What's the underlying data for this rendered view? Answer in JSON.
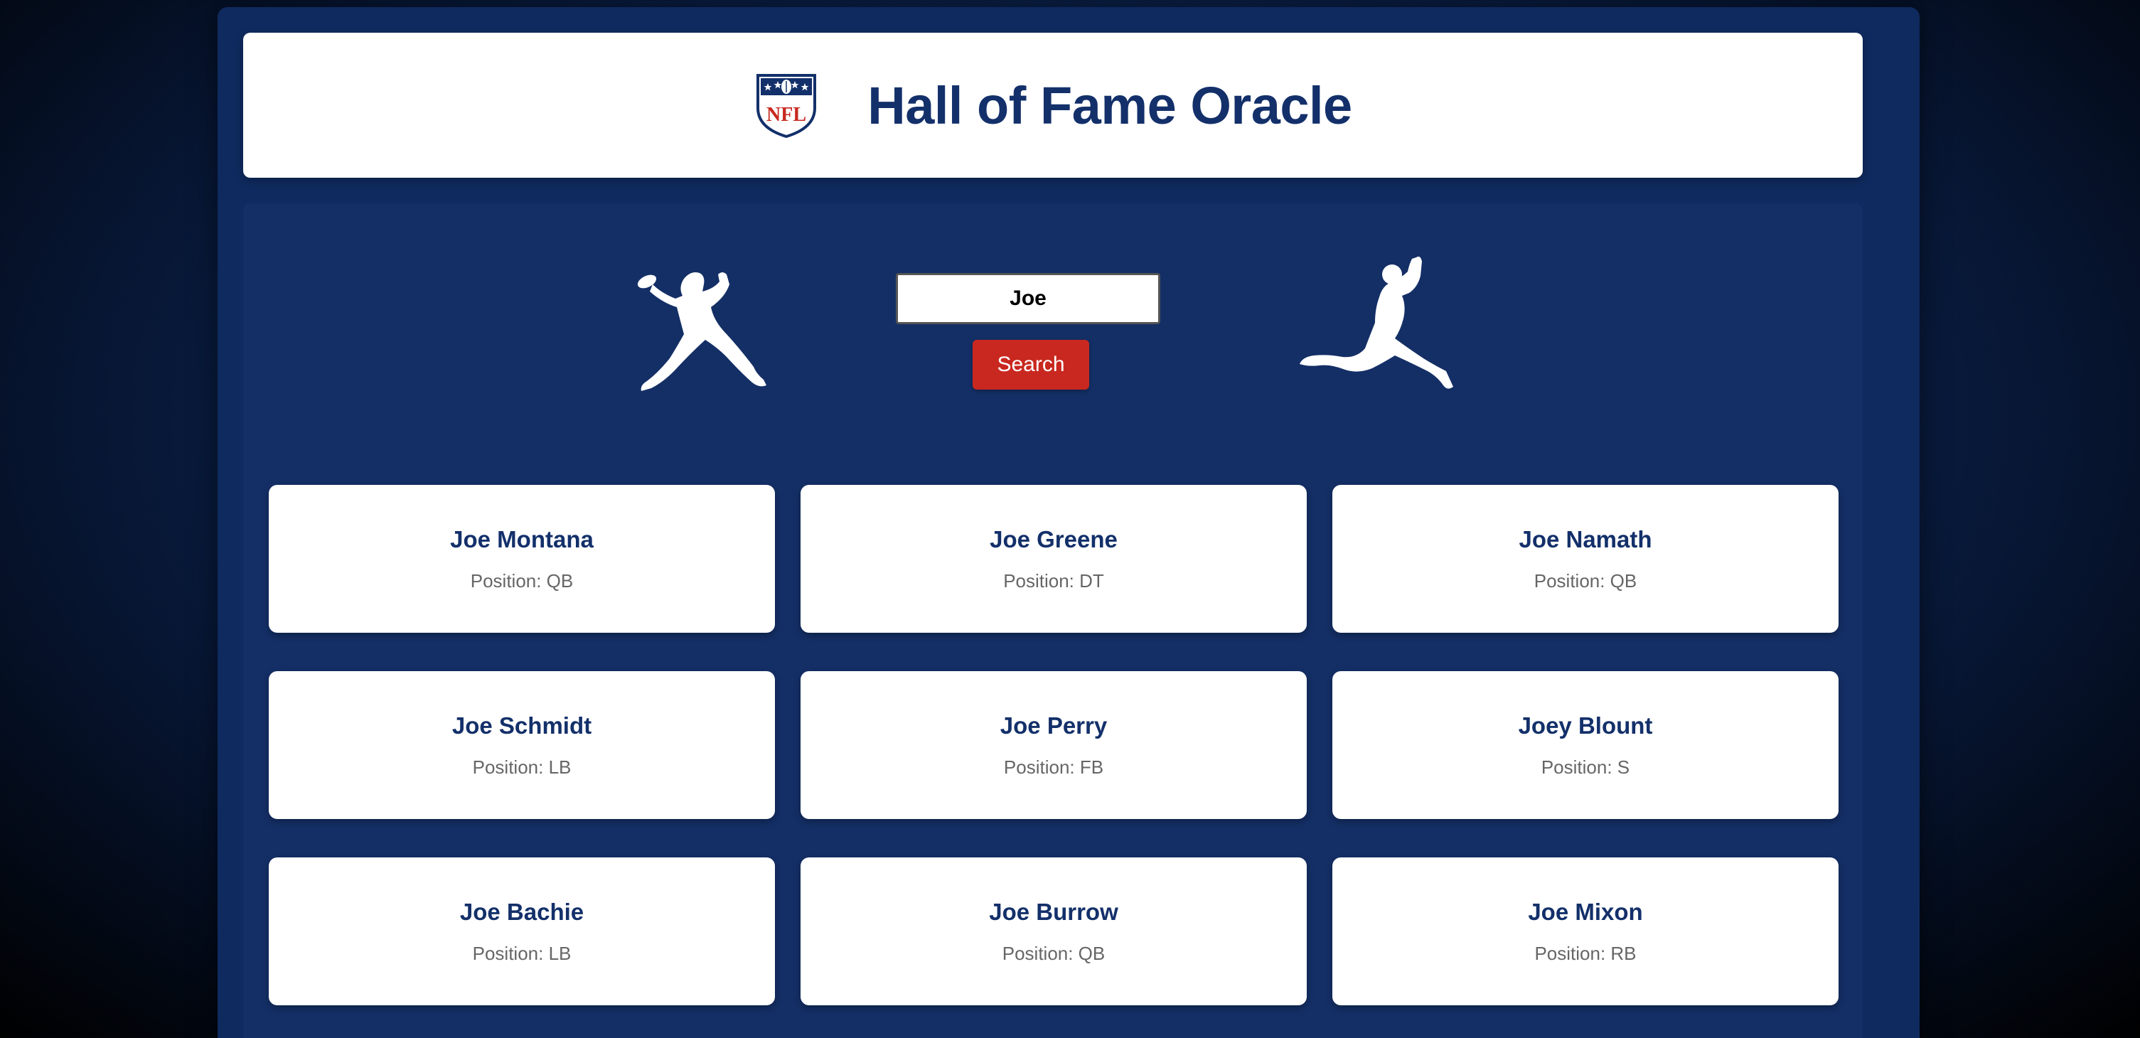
{
  "header": {
    "title": "Hall of Fame Oracle",
    "logo_text": "NFL",
    "logo_icon": "nfl-shield-logo"
  },
  "search": {
    "value": "Joe",
    "placeholder": "",
    "button_label": "Search"
  },
  "hero": {
    "left_icon": "quarterback-silhouette-icon",
    "right_icon": "receiver-silhouette-icon"
  },
  "results": [
    {
      "name": "Joe Montana",
      "position": "Position: QB"
    },
    {
      "name": "Joe Greene",
      "position": "Position: DT"
    },
    {
      "name": "Joe Namath",
      "position": "Position: QB"
    },
    {
      "name": "Joe Schmidt",
      "position": "Position: LB"
    },
    {
      "name": "Joe Perry",
      "position": "Position: FB"
    },
    {
      "name": "Joey Blount",
      "position": "Position: S"
    },
    {
      "name": "Joe Bachie",
      "position": "Position: LB"
    },
    {
      "name": "Joe Burrow",
      "position": "Position: QB"
    },
    {
      "name": "Joe Mixon",
      "position": "Position: RB"
    }
  ],
  "colors": {
    "brand_navy": "#13306a",
    "panel": "#142f66",
    "accent_red": "#c8281f",
    "card_bg": "#ffffff"
  }
}
